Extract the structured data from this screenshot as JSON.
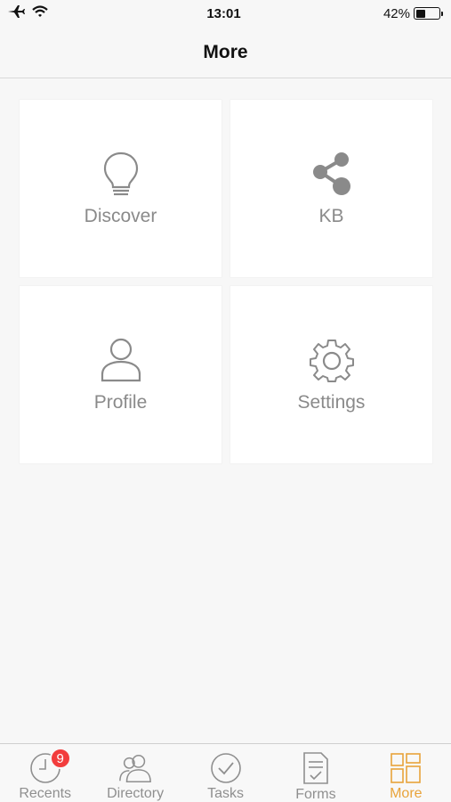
{
  "status_bar": {
    "time": "13:01",
    "battery_text": "42%",
    "battery_level": 0.42,
    "icons": [
      "airplane-icon",
      "wifi-icon",
      "battery-icon"
    ]
  },
  "nav": {
    "title": "More"
  },
  "tiles": [
    {
      "label": "Discover",
      "icon": "lightbulb-icon"
    },
    {
      "label": "KB",
      "icon": "share-icon"
    },
    {
      "label": "Profile",
      "icon": "user-icon"
    },
    {
      "label": "Settings",
      "icon": "gear-icon"
    }
  ],
  "tab_bar": {
    "tabs": [
      {
        "label": "Recents",
        "icon": "clock-icon",
        "badge": "9"
      },
      {
        "label": "Directory",
        "icon": "people-icon"
      },
      {
        "label": "Tasks",
        "icon": "check-circle-icon"
      },
      {
        "label": "Forms",
        "icon": "form-icon"
      },
      {
        "label": "More",
        "icon": "grid-icon",
        "active": true
      }
    ]
  },
  "colors": {
    "accent": "#e8a33a",
    "badge": "#f23d3d",
    "icon_gray": "#8a8a8a",
    "background": "#f7f7f7",
    "tile": "#ffffff"
  }
}
